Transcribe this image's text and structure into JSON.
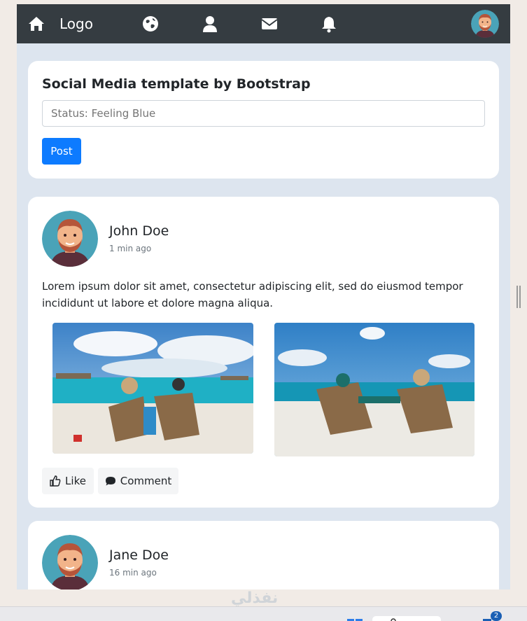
{
  "navbar": {
    "logo_label": "Logo",
    "icons": [
      "home-icon",
      "globe-icon",
      "user-icon",
      "envelope-icon",
      "bell-icon"
    ],
    "background": "#353c41"
  },
  "status_card": {
    "title": "Social Media template by Bootstrap",
    "input_placeholder": "Status: Feeling Blue",
    "post_label": "Post",
    "accent": "#0d7bff"
  },
  "posts": [
    {
      "author": "John Doe",
      "time": "1 min ago",
      "text": "Lorem ipsum dolor sit amet, consectetur adipiscing elit, sed do eiusmod tempor incididunt ut labore et dolore magna aliqua.",
      "like_label": "Like",
      "comment_label": "Comment"
    },
    {
      "author": "Jane Doe",
      "time": "16 min ago"
    }
  ],
  "taskbar": {
    "badge_count": "2"
  },
  "watermark": "نفذلي",
  "colors": {
    "page_background": "#dde5ef",
    "card_background": "#ffffff",
    "muted_text": "#6c757d"
  }
}
